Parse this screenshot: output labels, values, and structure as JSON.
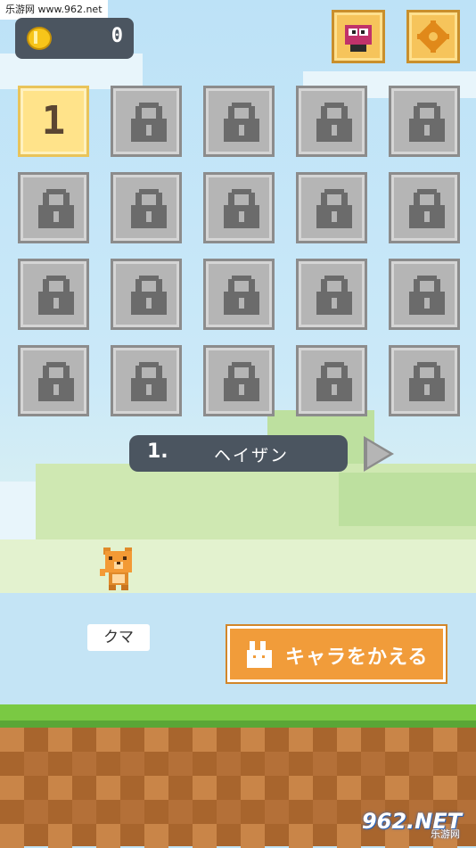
{
  "watermark_top": "乐游网 www.962.net",
  "coins": {
    "count": "0",
    "icon": "coin-icon"
  },
  "top_buttons": [
    {
      "name": "character-shop-button",
      "icon": "character-icon"
    },
    {
      "name": "settings-button",
      "icon": "gear-icon"
    }
  ],
  "stages": {
    "unlocked_label": "1",
    "locked_icon": "lock-icon"
  },
  "stage_selector": {
    "number": "1.",
    "name": "ヘイザン"
  },
  "character": {
    "name": "クマ"
  },
  "change_character_button": {
    "label": "キャラをかえる",
    "icon": "rabbit-icon"
  },
  "watermark_bottom": {
    "main": "962.NET",
    "sub": "乐游网"
  },
  "colors": {
    "accent": "#f19c3a",
    "panel": "#4b5560",
    "tile_locked": "#b5b5b5",
    "tile_open": "#ffe38a"
  }
}
